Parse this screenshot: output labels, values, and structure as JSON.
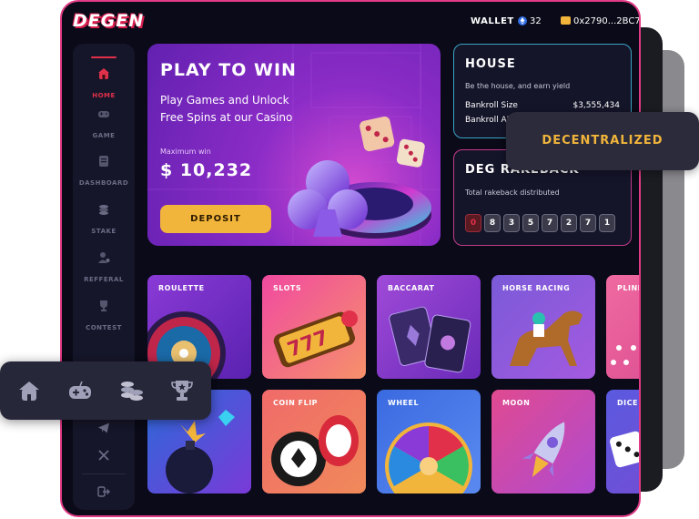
{
  "app": {
    "logo": "DEGEN",
    "wallet_label": "WALLET",
    "wallet_amount": "32",
    "address": "0x2790...2BC7"
  },
  "sidebar": {
    "items": [
      {
        "label": "HOME",
        "icon": "home-icon"
      },
      {
        "label": "GAME",
        "icon": "gamepad-icon"
      },
      {
        "label": "DASHBOARD",
        "icon": "dashboard-icon"
      },
      {
        "label": "STAKE",
        "icon": "coins-icon"
      },
      {
        "label": "REFFERAL",
        "icon": "referral-icon"
      },
      {
        "label": "CONTEST",
        "icon": "trophy-icon"
      }
    ],
    "socials": [
      "telegram-icon",
      "x-icon"
    ],
    "logout_icon": "logout-icon"
  },
  "hero": {
    "title": "PLAY TO WIN",
    "subtitle": "Play Games and Unlock Free Spins at our Casino",
    "max_win_label": "Maximum win",
    "max_win_amount": "$ 10,232",
    "deposit_label": "DEPOSIT"
  },
  "house": {
    "title": "HOUSE",
    "subtitle": "Be the house, and earn yield",
    "bankroll_size_label": "Bankroll Size",
    "bankroll_size_value": "$3,555,434",
    "bankroll_apr_label": "Bankroll AP"
  },
  "rakeback": {
    "title": "DEG RAKEBACK",
    "subtitle": "Total rakeback distributed",
    "digits": [
      "0",
      "8",
      "3",
      "5",
      "7",
      "2",
      "7",
      "1"
    ]
  },
  "badge": {
    "text": "DECENTRALIZED"
  },
  "games": {
    "row1": [
      "ROULETTE",
      "SLOTS",
      "BACCARAT",
      "HORSE RACING",
      "PLINKO"
    ],
    "row2": [
      "",
      "COIN FLIP",
      "WHEEL",
      "MOON",
      "DICE"
    ]
  },
  "mobile_nav": [
    "home-icon",
    "gamepad-icon",
    "coins-icon",
    "trophy-icon"
  ],
  "colors": {
    "accent_gold": "#f2b53b",
    "accent_red": "#e0304a",
    "border_pink": "#e23b86",
    "house_border": "#3aa4c4"
  }
}
